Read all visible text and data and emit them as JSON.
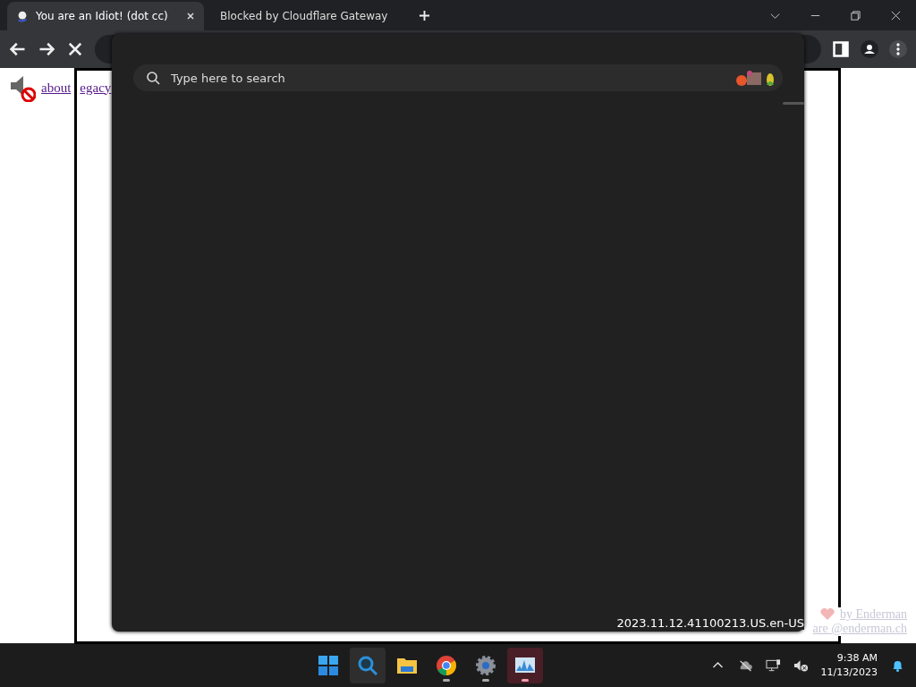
{
  "tabs": [
    {
      "title": "You are an Idiot! (dot cc)",
      "selected": true,
      "kind": "site"
    },
    {
      "title": "Blocked by Cloudflare Gateway",
      "selected": false,
      "kind": "globe"
    }
  ],
  "page": {
    "links": [
      "about",
      "egacy"
    ],
    "credits": [
      "by Enderman",
      "are @enderman.ch"
    ]
  },
  "search_panel": {
    "placeholder": "Type here to search",
    "version": "2023.11.12.41100213.US.en-US"
  },
  "taskbar": {
    "apps": [
      {
        "kind": "start",
        "selected": false,
        "running": false
      },
      {
        "kind": "search",
        "selected": true,
        "running": false
      },
      {
        "kind": "folder",
        "selected": false,
        "running": false
      },
      {
        "kind": "chrome",
        "selected": false,
        "running": true
      },
      {
        "kind": "gear",
        "selected": false,
        "running": true
      },
      {
        "kind": "monitor",
        "selected": true,
        "running": true
      }
    ],
    "time": "9:38 AM",
    "date": "11/13/2023"
  }
}
